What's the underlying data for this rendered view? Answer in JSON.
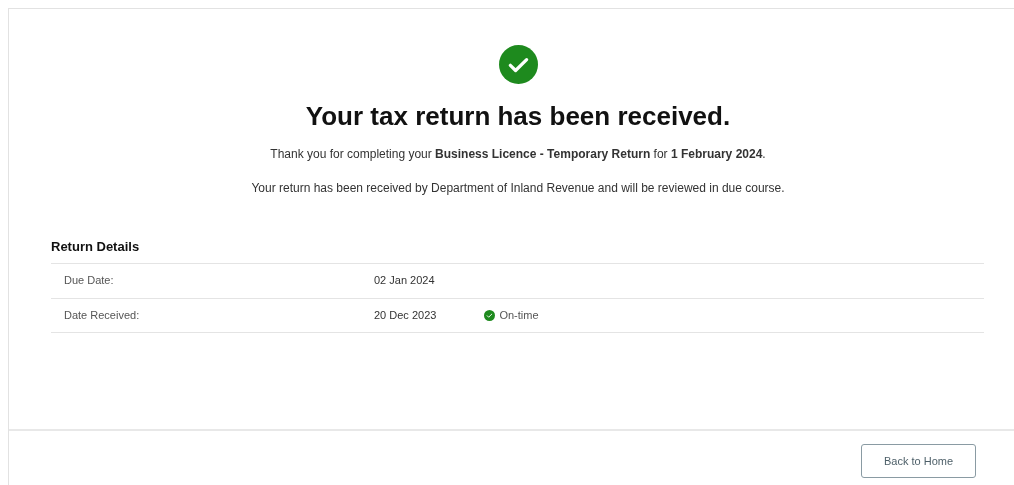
{
  "confirmation": {
    "title": "Your tax return has been received.",
    "message": "Thank you for completing your **Business Licence - Temporary Return** for **1 February 2024**.",
    "note": "Your return has been received by Department of Inland Revenue and will be reviewed in due course."
  },
  "return_details": {
    "heading": "Return Details",
    "rows": [
      {
        "label": "Due Date:",
        "value": "02 Jan 2024"
      },
      {
        "label": "Date Received:",
        "value": "20 Dec 2023",
        "status": {
          "kind": "ok",
          "text": "On-time"
        }
      }
    ]
  },
  "footer": {
    "button": "Back to Home"
  }
}
